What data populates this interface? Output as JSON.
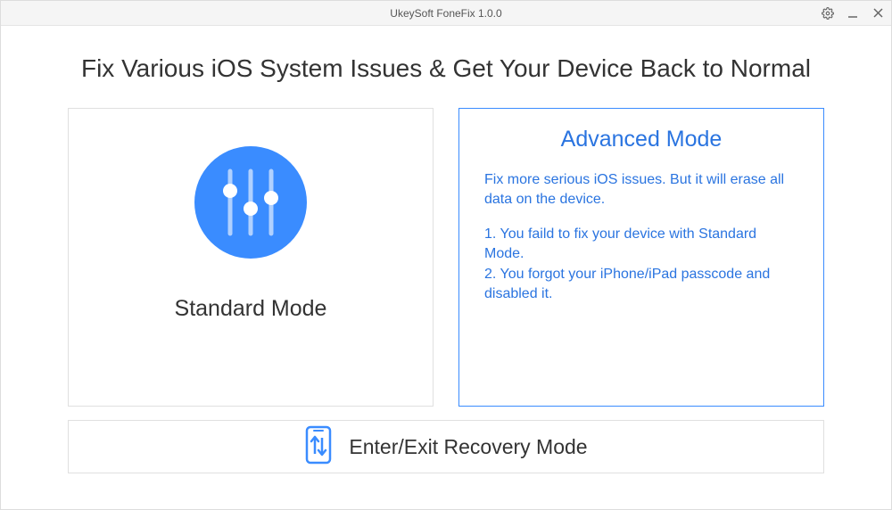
{
  "window": {
    "title": "UkeySoft FoneFix 1.0.0"
  },
  "headline": "Fix Various iOS System Issues & Get Your Device Back to Normal",
  "standardMode": {
    "label": "Standard Mode"
  },
  "advancedMode": {
    "title": "Advanced Mode",
    "description": "Fix more serious iOS issues. But it will erase all data on the device.",
    "point1": "1. You faild to fix your device with Standard Mode.",
    "point2": "2. You forgot your iPhone/iPad passcode and disabled it."
  },
  "recovery": {
    "label": "Enter/Exit Recovery Mode"
  },
  "colors": {
    "accent": "#3a8cff",
    "accentText": "#2a74e0"
  }
}
